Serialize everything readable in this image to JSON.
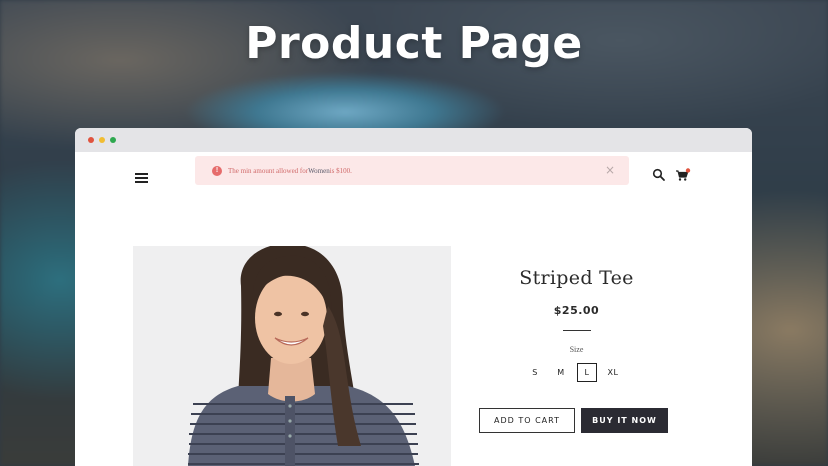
{
  "hero": {
    "title": "Product Page"
  },
  "alert": {
    "text_before": "The min amount allowed for ",
    "link_text": "Women",
    "text_after": " is $100.",
    "icon_glyph": "!",
    "close_glyph": "×"
  },
  "product": {
    "title": "Striped Tee",
    "price": "$25.00",
    "size_label": "Size",
    "sizes": [
      "S",
      "M",
      "L",
      "XL"
    ],
    "selected_size": "L",
    "add_to_cart": "ADD TO CART",
    "buy_now": "BUY IT NOW"
  },
  "colors": {
    "alert_bg": "#fce8e8",
    "alert_text": "#d06a6a",
    "buy_button_bg": "#2b2b33",
    "cart_badge": "#e0533e"
  },
  "icons": {
    "menu": "hamburger-icon",
    "search": "search-icon",
    "cart": "cart-icon"
  }
}
